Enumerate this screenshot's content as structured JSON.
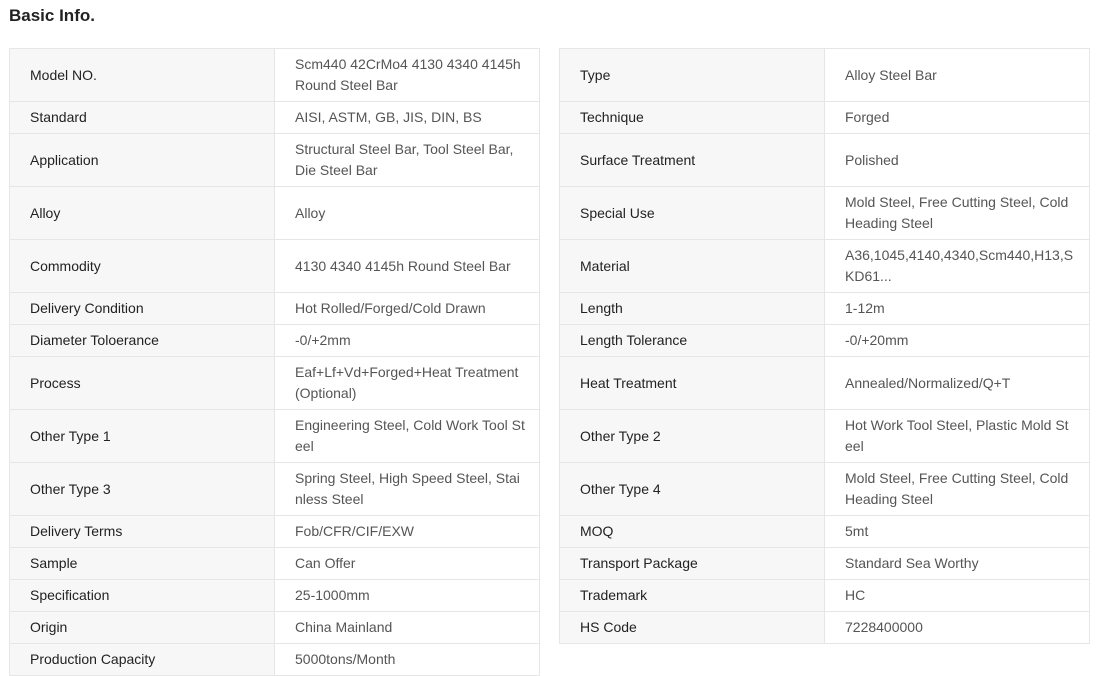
{
  "title": "Basic Info.",
  "left_rows": [
    {
      "label": "Model NO.",
      "value": "Scm440 42CrMo4 4130 4340 4145h Round Steel Bar"
    },
    {
      "label": "Standard",
      "value": "AISI, ASTM, GB, JIS, DIN, BS"
    },
    {
      "label": "Application",
      "value": "Structural Steel Bar, Tool Steel Bar, Die Steel Bar"
    },
    {
      "label": "Alloy",
      "value": "Alloy"
    },
    {
      "label": "Commodity",
      "value": "4130 4340 4145h Round Steel Bar"
    },
    {
      "label": "Delivery Condition",
      "value": "Hot Rolled/Forged/Cold Drawn"
    },
    {
      "label": "Diameter Toloerance",
      "value": "-0/+2mm"
    },
    {
      "label": "Process",
      "value": "Eaf+Lf+Vd+Forged+Heat Treatment(Optional)"
    },
    {
      "label": "Other Type 1",
      "value": "Engineering Steel, Cold Work Tool Steel"
    },
    {
      "label": "Other Type 3",
      "value": "Spring Steel, High Speed Steel, Stainless Steel"
    },
    {
      "label": "Delivery Terms",
      "value": "Fob/CFR/CIF/EXW"
    },
    {
      "label": "Sample",
      "value": "Can Offer"
    },
    {
      "label": "Specification",
      "value": "25-1000mm"
    },
    {
      "label": "Origin",
      "value": "China Mainland"
    },
    {
      "label": "Production Capacity",
      "value": "5000tons/Month"
    }
  ],
  "right_rows": [
    {
      "label": "Type",
      "value": "Alloy Steel Bar"
    },
    {
      "label": "Technique",
      "value": "Forged"
    },
    {
      "label": "Surface Treatment",
      "value": "Polished"
    },
    {
      "label": "Special Use",
      "value": "Mold Steel, Free Cutting Steel, Cold Heading Steel"
    },
    {
      "label": "Material",
      "value": "A36,1045,4140,4340,Scm440,H13,SKD61..."
    },
    {
      "label": "Length",
      "value": "1-12m"
    },
    {
      "label": "Length Tolerance",
      "value": "-0/+20mm"
    },
    {
      "label": "Heat Treatment",
      "value": "Annealed/Normalized/Q+T"
    },
    {
      "label": "Other Type 2",
      "value": "Hot Work Tool Steel, Plastic Mold Steel"
    },
    {
      "label": "Other Type 4",
      "value": "Mold Steel, Free Cutting Steel, Cold Heading Steel"
    },
    {
      "label": "MOQ",
      "value": "5mt"
    },
    {
      "label": "Transport Package",
      "value": "Standard Sea Worthy"
    },
    {
      "label": "Trademark",
      "value": "HC"
    },
    {
      "label": "HS Code",
      "value": "7228400000"
    }
  ]
}
